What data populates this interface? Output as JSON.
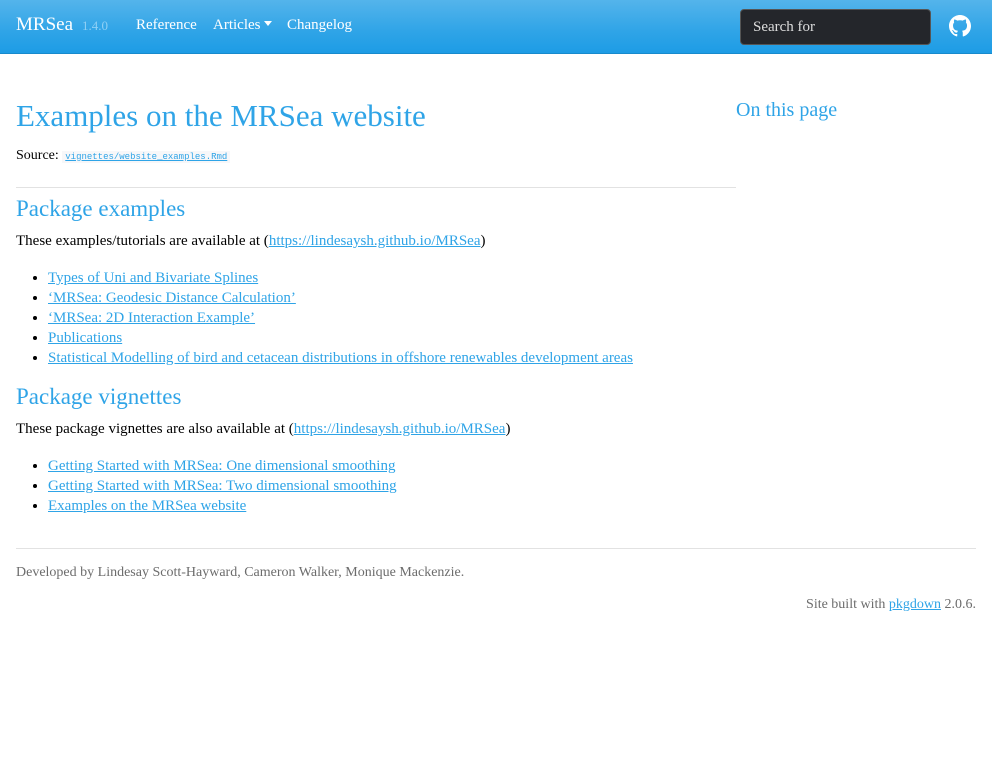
{
  "navbar": {
    "brand": "MRSea",
    "version": "1.4.0",
    "links": [
      "Reference",
      "Articles",
      "Changelog"
    ],
    "search_placeholder": "Search for"
  },
  "article": {
    "title": "Examples on the MRSea website",
    "source_label": "Source:",
    "source_file": "vignettes/website_examples.Rmd",
    "sections": [
      {
        "heading": "Package examples",
        "intro_prefix": "These examples/tutorials are available at (",
        "intro_link": "https://lindesaysh.github.io/MRSea",
        "intro_suffix": ")",
        "items": [
          "Types of Uni and Bivariate Splines",
          "‘MRSea: Geodesic Distance Calculation’",
          "‘MRSea: 2D Interaction Example’",
          "Publications",
          "Statistical Modelling of bird and cetacean distributions in offshore renewables development areas"
        ]
      },
      {
        "heading": "Package vignettes",
        "intro_prefix": "These package vignettes are also available at (",
        "intro_link": "https://lindesaysh.github.io/MRSea",
        "intro_suffix": ")",
        "items": [
          "Getting Started with MRSea: One dimensional smoothing",
          "Getting Started with MRSea: Two dimensional smoothing",
          "Examples on the MRSea website"
        ]
      }
    ]
  },
  "toc": {
    "title": "On this page"
  },
  "footer": {
    "developed": "Developed by Lindesay Scott-Hayward, Cameron Walker, Monique Mackenzie.",
    "built_prefix": "Site built with",
    "built_link": "pkgdown",
    "built_suffix": "2.0.6."
  }
}
